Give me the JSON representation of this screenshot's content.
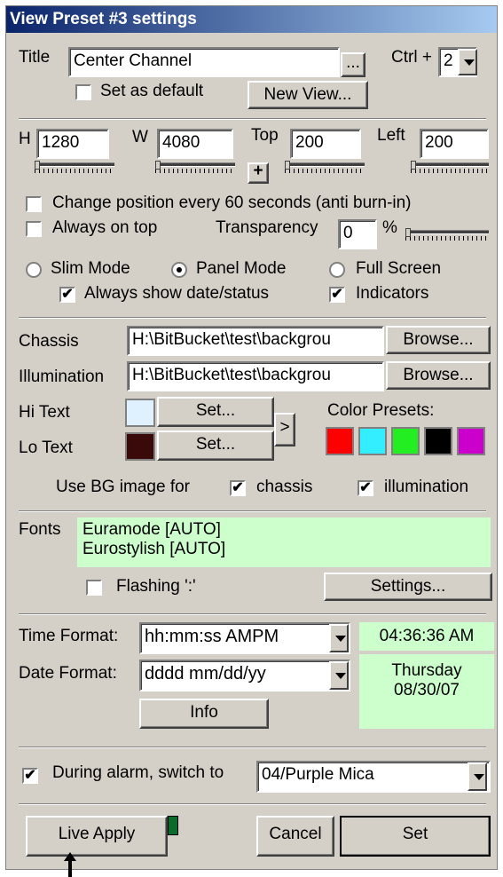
{
  "title_bar": "View Preset #3 settings",
  "title_section": {
    "title_label": "Title",
    "title_value": "Center Channel",
    "ellipsis_label": "...",
    "ctrl_label": "Ctrl +",
    "ctrl_value": "2",
    "set_default_label": "Set as default",
    "set_default_checked": false,
    "new_view_label": "New View..."
  },
  "dimensions": {
    "h_label": "H",
    "h_value": "1280",
    "w_label": "W",
    "w_value": "4080",
    "top_label": "Top",
    "top_value": "200",
    "left_label": "Left",
    "left_value": "200",
    "plus_label": "+"
  },
  "options": {
    "change_position_label": "Change position every 60 seconds (anti burn-in)",
    "change_position_checked": false,
    "always_on_top_label": "Always on top",
    "always_on_top_checked": false,
    "transparency_label": "Transparency",
    "transparency_value": "0",
    "percent_label": "%"
  },
  "modes": {
    "slim_label": "Slim Mode",
    "panel_label": "Panel Mode",
    "full_label": "Full Screen",
    "selected": "Panel Mode",
    "always_show_label": "Always show date/status",
    "always_show_checked": true,
    "indicators_label": "Indicators",
    "indicators_checked": true
  },
  "images": {
    "chassis_label": "Chassis",
    "chassis_value": "H:\\BitBucket\\test\\backgrou",
    "illumination_label": "Illumination",
    "illumination_value": "H:\\BitBucket\\test\\backgrou",
    "browse_label": "Browse..."
  },
  "colors": {
    "hi_text_label": "Hi Text",
    "lo_text_label": "Lo Text",
    "set_label": "Set...",
    "arrow_label": ">",
    "presets_label": "Color Presets:",
    "hi_color": "#dff1ff",
    "lo_color": "#3a0a0a",
    "presets": [
      "#ff0000",
      "#33eeff",
      "#22ee22",
      "#000000",
      "#cc00cc"
    ],
    "use_bg_label": "Use BG image for",
    "chassis_label": "chassis",
    "chassis_checked": true,
    "illumination_label": "illumination",
    "illumination_checked": true
  },
  "fonts": {
    "label": "Fonts",
    "line1": "Euramode [AUTO]",
    "line2": "Eurostylish [AUTO]",
    "flashing_label": "Flashing ':'",
    "flashing_checked": false,
    "settings_label": "Settings..."
  },
  "format": {
    "time_label": "Time Format:",
    "time_value": "hh:mm:ss AMPM",
    "time_preview": "04:36:36 AM",
    "date_label": "Date Format:",
    "date_value": "dddd mm/dd/yy",
    "date_preview_day": "Thursday",
    "date_preview_date": "08/30/07",
    "info_label": "Info"
  },
  "alarm": {
    "label": "During alarm, switch to",
    "checked": true,
    "value": "04/Purple Mica"
  },
  "actions": {
    "live_apply": "Live Apply",
    "cancel": "Cancel",
    "set": "Set"
  }
}
